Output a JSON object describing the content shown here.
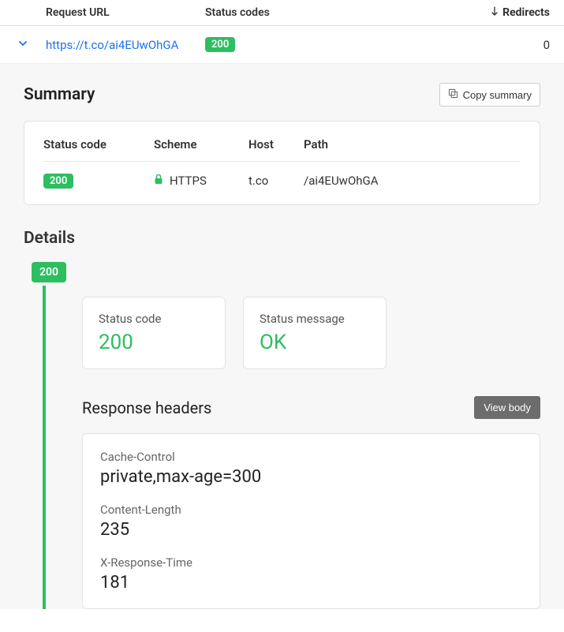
{
  "table": {
    "headers": {
      "url": "Request URL",
      "status": "Status codes",
      "redirects": "Redirects"
    },
    "row": {
      "url": "https://t.co/ai4EUwOhGA",
      "status": "200",
      "redirects": "0"
    }
  },
  "summary": {
    "title": "Summary",
    "copy_label": "Copy summary",
    "headers": {
      "status": "Status code",
      "scheme": "Scheme",
      "host": "Host",
      "path": "Path"
    },
    "row": {
      "status": "200",
      "scheme": "HTTPS",
      "host": "t.co",
      "path": "/ai4EUwOhGA"
    }
  },
  "details": {
    "title": "Details",
    "badge": "200",
    "status_code": {
      "label": "Status code",
      "value": "200"
    },
    "status_message": {
      "label": "Status message",
      "value": "OK"
    },
    "response_headers_title": "Response headers",
    "view_body_label": "View body",
    "headers": [
      {
        "name": "Cache-Control",
        "value": "private,max-age=300"
      },
      {
        "name": "Content-Length",
        "value": "235"
      },
      {
        "name": "X-Response-Time",
        "value": "181"
      }
    ]
  }
}
